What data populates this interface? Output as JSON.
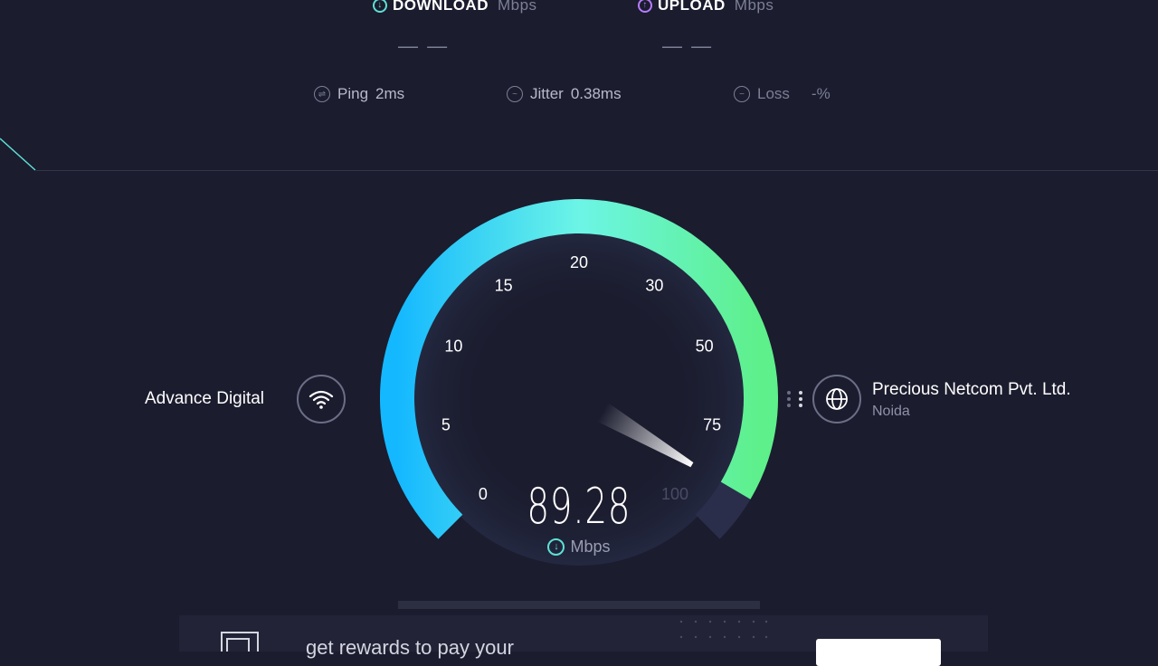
{
  "header": {
    "download_label": "DOWNLOAD",
    "download_unit": "Mbps",
    "download_value": "— —",
    "upload_label": "UPLOAD",
    "upload_unit": "Mbps",
    "upload_value": "— —"
  },
  "stats": {
    "ping_label": "Ping",
    "ping_value": "2ms",
    "jitter_label": "Jitter",
    "jitter_value": "0.38ms",
    "loss_label": "Loss",
    "loss_value": "-%"
  },
  "isp": {
    "name": "Advance Digital"
  },
  "server": {
    "name": "Precious Netcom Pvt. Ltd.",
    "location": "Noida"
  },
  "gauge": {
    "ticks": [
      {
        "label": "0",
        "value": 0
      },
      {
        "label": "5",
        "value": 5
      },
      {
        "label": "10",
        "value": 10
      },
      {
        "label": "15",
        "value": 15
      },
      {
        "label": "20",
        "value": 20
      },
      {
        "label": "30",
        "value": 30
      },
      {
        "label": "50",
        "value": 50
      },
      {
        "label": "75",
        "value": 75
      },
      {
        "label": "100",
        "value": 100
      }
    ],
    "speed": "89.28",
    "speed_numeric": 89.28,
    "unit": "Mbps"
  },
  "banner": {
    "text": "get rewards to pay your"
  },
  "colors": {
    "background": "#1b1c2e",
    "arc_start": "#14b8ff",
    "arc_mid": "#6cf5e6",
    "arc_end": "#5ef08a",
    "download_accent": "#5ee0d6",
    "upload_accent": "#b77cff"
  },
  "icons": {
    "download": "download-icon",
    "upload": "upload-icon",
    "ping": "ping-icon",
    "jitter": "jitter-icon",
    "loss": "loss-icon",
    "wifi": "wifi-icon",
    "globe": "globe-icon"
  }
}
